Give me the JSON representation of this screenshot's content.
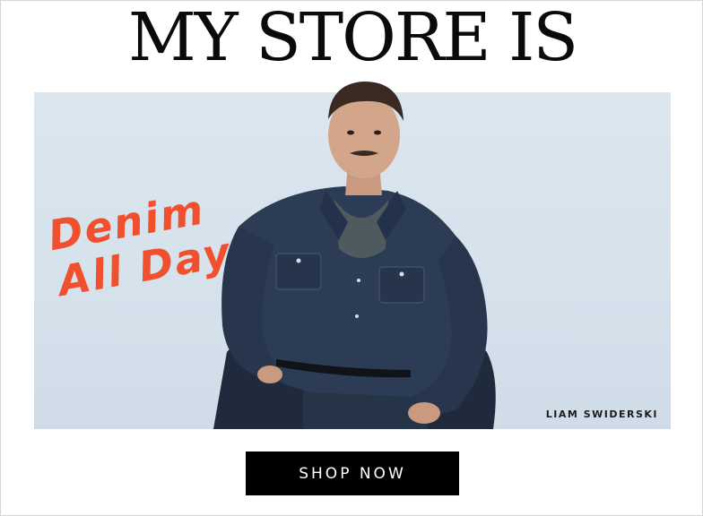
{
  "headline": "MY STORE IS",
  "tagline": {
    "line1": "Denim",
    "line2": "All Day"
  },
  "credit": "LIAM SWIDERSKI",
  "cta": {
    "label": "SHOP NOW"
  },
  "colors": {
    "accent": "#f0502d",
    "background": "#d9e4ee",
    "button": "#000000",
    "denim": "#2c3b52"
  }
}
